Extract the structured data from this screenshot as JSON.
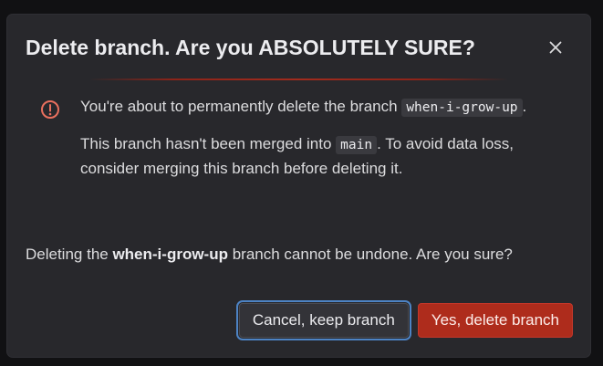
{
  "modal": {
    "title": "Delete branch. Are you ABSOLUTELY SURE?",
    "close_icon": "close-icon",
    "alert": {
      "icon": "warning-circle-icon",
      "icon_color": "#e9705e",
      "line1_prefix": "You're about to permanently delete the branch ",
      "branch_name": "when-i-grow-up",
      "line1_suffix": ".",
      "line2_prefix": "This branch hasn't been merged into ",
      "target_branch": "main",
      "line2_suffix": ". To avoid data loss, consider merging this branch before deleting it."
    },
    "confirm": {
      "prefix": "Deleting the ",
      "branch_name": "when-i-grow-up",
      "suffix": " branch cannot be undone. Are you sure?"
    },
    "buttons": {
      "cancel_label": "Cancel, keep branch",
      "delete_label": "Yes, delete branch"
    }
  },
  "colors": {
    "background": "#111113",
    "modal": "#28282c",
    "danger": "#ae2c1c",
    "focus_ring": "#4d83c4",
    "text": "#dcdcde"
  }
}
